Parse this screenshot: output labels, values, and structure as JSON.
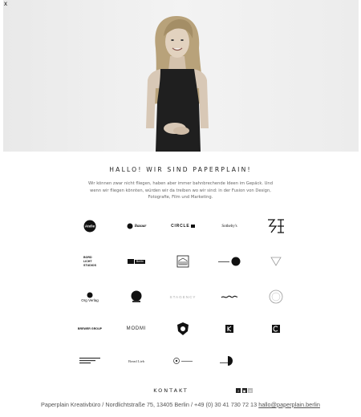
{
  "close_button": {
    "label": "x"
  },
  "hero": {
    "image": "woman-portrait-photo"
  },
  "headline": "HALLO! WIR SIND PAPERPLAIN!",
  "intro": "Wir können zwar nicht fliegen, haben aber immer bahnbrechende Ideen im Gepäck. Und wenn wir fliegen könnten, würden wir da treiben wo wir sind: in der Fusion von Design, Fotografie, Film und Marketing.",
  "clients": [
    {
      "name": "studio-logo"
    },
    {
      "name": "Bazaar"
    },
    {
      "name": "CIRCLE"
    },
    {
      "name": "Sotheby's"
    },
    {
      "name": "ART FILM"
    },
    {
      "name": "BORD LICHT STUDIOS",
      "l1": "BORD",
      "l2": "LICHT",
      "l3": "STUDIOS"
    },
    {
      "name": "Berlin"
    },
    {
      "name": "building-logo"
    },
    {
      "name": "circle-text-logo"
    },
    {
      "name": "triangle-logo"
    },
    {
      "name": "Org Verlag"
    },
    {
      "name": "badge-logo"
    },
    {
      "name": "STAGENCY"
    },
    {
      "name": "script-logo"
    },
    {
      "name": "ring-logo"
    },
    {
      "name": "BREWER GROUP"
    },
    {
      "name": "MODMI"
    },
    {
      "name": "crest-logo"
    },
    {
      "name": "K-logo"
    },
    {
      "name": "C-logo"
    },
    {
      "name": "text-block-logo"
    },
    {
      "name": "Bread Lieb"
    },
    {
      "name": "dot-logo"
    },
    {
      "name": "half-circle-logo"
    }
  ],
  "kontakt": "KONTAKT",
  "social": {
    "facebook": "f",
    "second": "▣",
    "third": "✉"
  },
  "footer": {
    "address": "Paperplain Kreativbüro / Nordlichtstraße 75, 13405 Berlin / +49 (0) 30 41 730 72 13 ",
    "email": "hallo@paperplain.berlin"
  },
  "colors": {
    "text": "#333333",
    "muted": "#666666",
    "background": "#ffffff"
  }
}
